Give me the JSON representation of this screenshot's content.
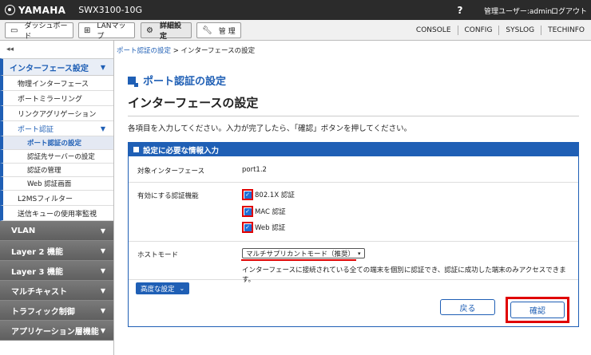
{
  "header": {
    "brand": "YAMAHA",
    "model": "SWX3100-10G",
    "help": "?",
    "user": "管理ユーザー:admin",
    "logout": "ログアウト"
  },
  "tabs": [
    {
      "label": "ダッシュボード",
      "icon": "dashboard-icon"
    },
    {
      "label": "LANマップ",
      "icon": "lanmap-icon"
    },
    {
      "label": "詳細設定",
      "icon": "gear-icon"
    },
    {
      "label": "管 理",
      "icon": "wrench-icon"
    }
  ],
  "toplinks": [
    "CONSOLE",
    "CONFIG",
    "SYSLOG",
    "TECHINFO"
  ],
  "sidebar": {
    "collapse": "◂◂",
    "section_title": "インターフェース設定",
    "items": [
      "物理インターフェース",
      "ポートミラーリング",
      "リンクアグリゲーション",
      "ポート認証"
    ],
    "subitems": [
      "ポート認証の設定",
      "認証先サーバーの設定",
      "認証の管理",
      "Web 認証画面"
    ],
    "items_after": [
      "L2MSフィルター",
      "送信キューの使用率監視"
    ],
    "groups": [
      "VLAN",
      "Layer 2 機能",
      "Layer 3 機能",
      "マルチキャスト",
      "トラフィック制御",
      "アプリケーション層機能"
    ]
  },
  "main": {
    "breadcrumb_link": "ポート認証の設定",
    "breadcrumb_sep": " > ",
    "breadcrumb_current": "インターフェースの設定",
    "section_title": "ポート認証の設定",
    "page_title": "インターフェースの設定",
    "instruction": "各項目を入力してください。入力が完了したら、「確認」ボタンを押してください。",
    "panel_title": "設定に必要な情報入力",
    "target_label": "対象インターフェース",
    "target_value": "port1.2",
    "auth_label": "有効にする認証機能",
    "auth_options": [
      "802.1X 認証",
      "MAC 認証",
      "Web 認証"
    ],
    "auth_checked": [
      true,
      true,
      true
    ],
    "host_label": "ホストモード",
    "host_value": "マルチサプリカントモード（推奨）",
    "host_hint": "インターフェースに接続されている全ての端末を個別に認証でき、認証に成功した端末のみアクセスできます。",
    "advanced": "高度な設定",
    "back": "戻る",
    "confirm": "確認"
  }
}
